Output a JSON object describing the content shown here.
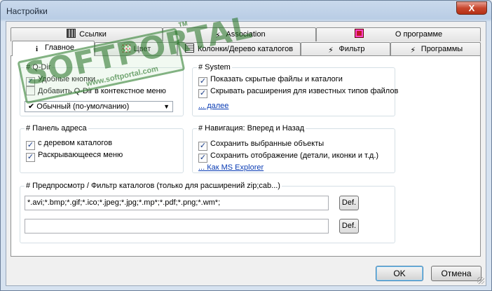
{
  "window": {
    "title": "Настройки",
    "close_symbol": "X"
  },
  "tabs_row1": [
    {
      "label": "Ссылки",
      "icon": "links-icon"
    },
    {
      "label": "Association",
      "icon": "association-icon"
    },
    {
      "label": "О программе",
      "icon": "about-icon"
    }
  ],
  "tabs_row2": [
    {
      "label": "Главное",
      "icon": "info-icon",
      "active": true
    },
    {
      "label": "Цвет",
      "icon": "color-icon"
    },
    {
      "label": "Колонки/Дерево каталогов",
      "icon": "columns-icon"
    },
    {
      "label": "Фильтр",
      "icon": "filter-icon"
    },
    {
      "label": "Программы",
      "icon": "programs-icon"
    }
  ],
  "qdir_group": {
    "title": "# Q-Dir",
    "checkboxes": [
      {
        "label": "Удобные кнопки",
        "checked": true
      },
      {
        "label": "Добавить Q-Dir в контекстное меню",
        "checked": false
      }
    ],
    "combo_value": "Обычный (по-умолчанию)"
  },
  "system_group": {
    "title": "# System",
    "checkboxes": [
      {
        "label": "Показать скрытые файлы и каталоги",
        "checked": true
      },
      {
        "label": "Скрывать расширения для известных типов файлов",
        "checked": true
      }
    ],
    "link": "... далее"
  },
  "address_group": {
    "title": "# Панель адреса",
    "checkboxes": [
      {
        "label": "с деревом каталогов",
        "checked": true
      },
      {
        "label": "Раскрывающееся меню",
        "checked": true
      }
    ]
  },
  "nav_group": {
    "title": "# Навигация: Вперед и Назад",
    "checkboxes": [
      {
        "label": "Сохранить выбранные объекты",
        "checked": true
      },
      {
        "label": "Сохранить отображение (детали, иконки и т.д.)",
        "checked": true
      }
    ],
    "link": "... Как MS Explorer"
  },
  "preview_group": {
    "title": "# Предпросмотр / Фильтр каталогов (только для расширений zip;cab...)",
    "field1_value": "*.avi;*.bmp;*.gif;*.ico;*.jpeg;*.jpg;*.mp*;*.pdf;*.png;*.wm*;",
    "field2_value": "",
    "def_label": "Def."
  },
  "footer": {
    "ok_label": "OK",
    "cancel_label": "Отмена"
  },
  "watermark": {
    "text": "SOFTPORTAL",
    "url": "www.softportal.com",
    "tm": "TM"
  },
  "colors": {
    "link": "#0a3cb4",
    "close_button": "#c8472e",
    "watermark": "#1e6e1e"
  }
}
